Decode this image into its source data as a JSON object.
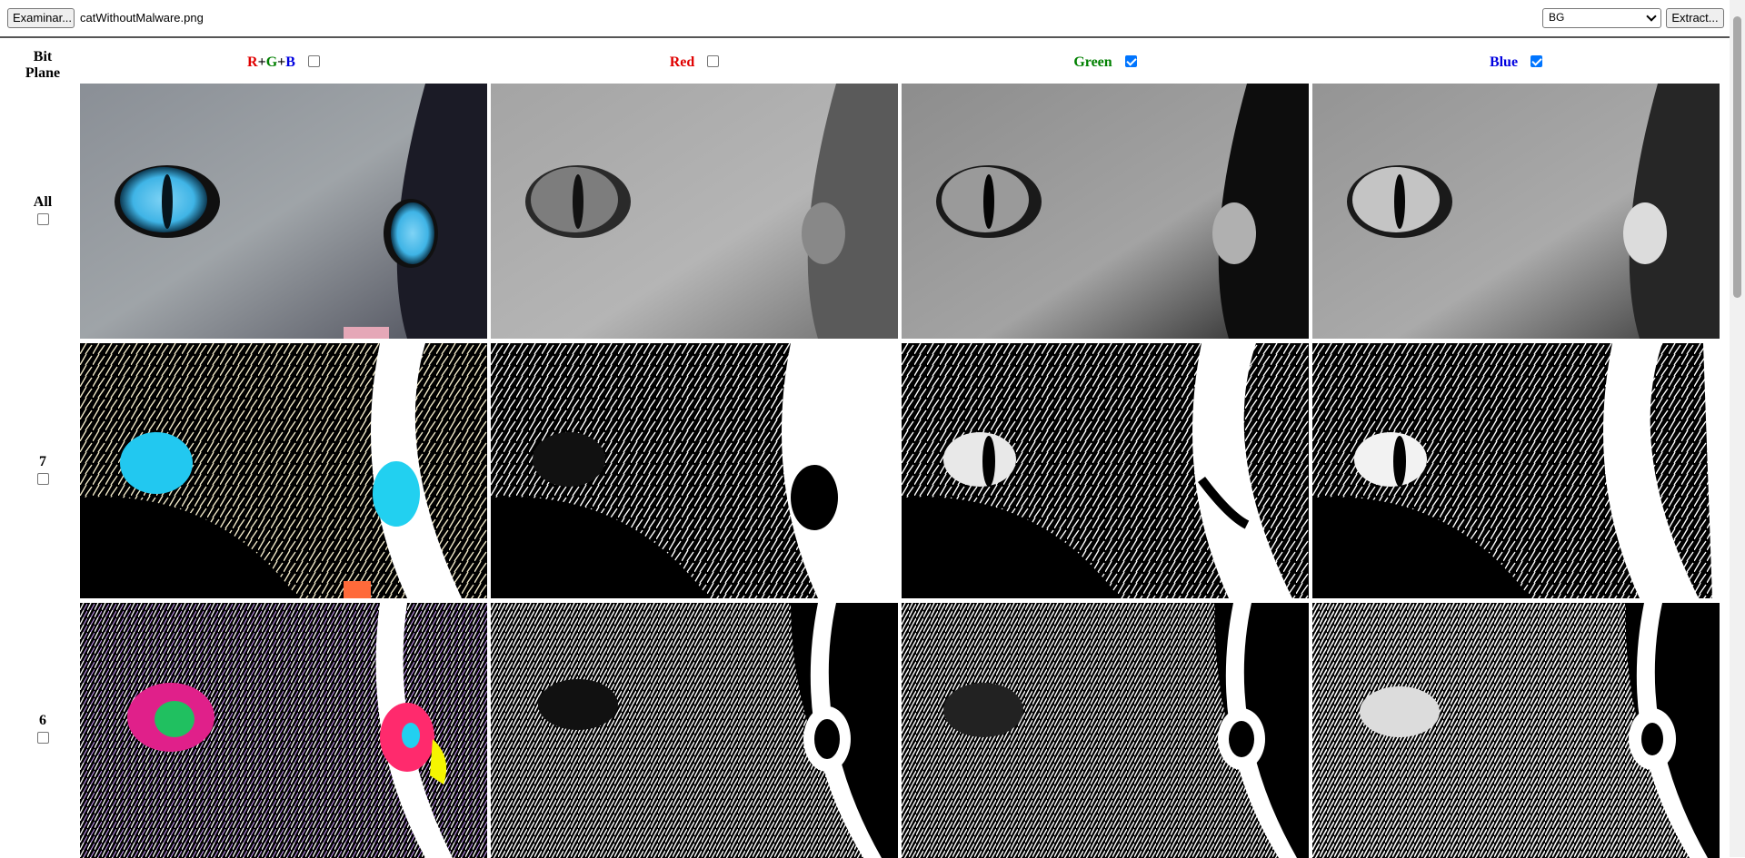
{
  "toolbar": {
    "browse_label": "Examinar...",
    "file_name": "catWithoutMalware.png",
    "mode_selected": "BG",
    "extract_label": "Extract..."
  },
  "grid": {
    "corner_label_line1": "Bit",
    "corner_label_line2": "Plane",
    "columns": [
      {
        "key": "rgb",
        "parts": [
          "R",
          "+",
          "G",
          "+",
          "B"
        ],
        "part_colors": [
          "#e00000",
          "#000000",
          "#008000",
          "#000000",
          "#0000e0"
        ],
        "checked": false
      },
      {
        "key": "red",
        "label": "Red",
        "color": "#e00000",
        "checked": false
      },
      {
        "key": "green",
        "label": "Green",
        "color": "#008000",
        "checked": true
      },
      {
        "key": "blue",
        "label": "Blue",
        "color": "#0000e0",
        "checked": true
      }
    ],
    "rows": [
      {
        "label": "All",
        "checked": false
      },
      {
        "label": "7",
        "checked": false
      },
      {
        "label": "6",
        "checked": false
      }
    ]
  },
  "colors": {
    "divider": "#555555",
    "accent_checkbox": "#0075ff",
    "eye_blue": "#3fb4e6",
    "eye_cyan": "#22d0f0",
    "eye_magenta": "#ff2a6d"
  }
}
